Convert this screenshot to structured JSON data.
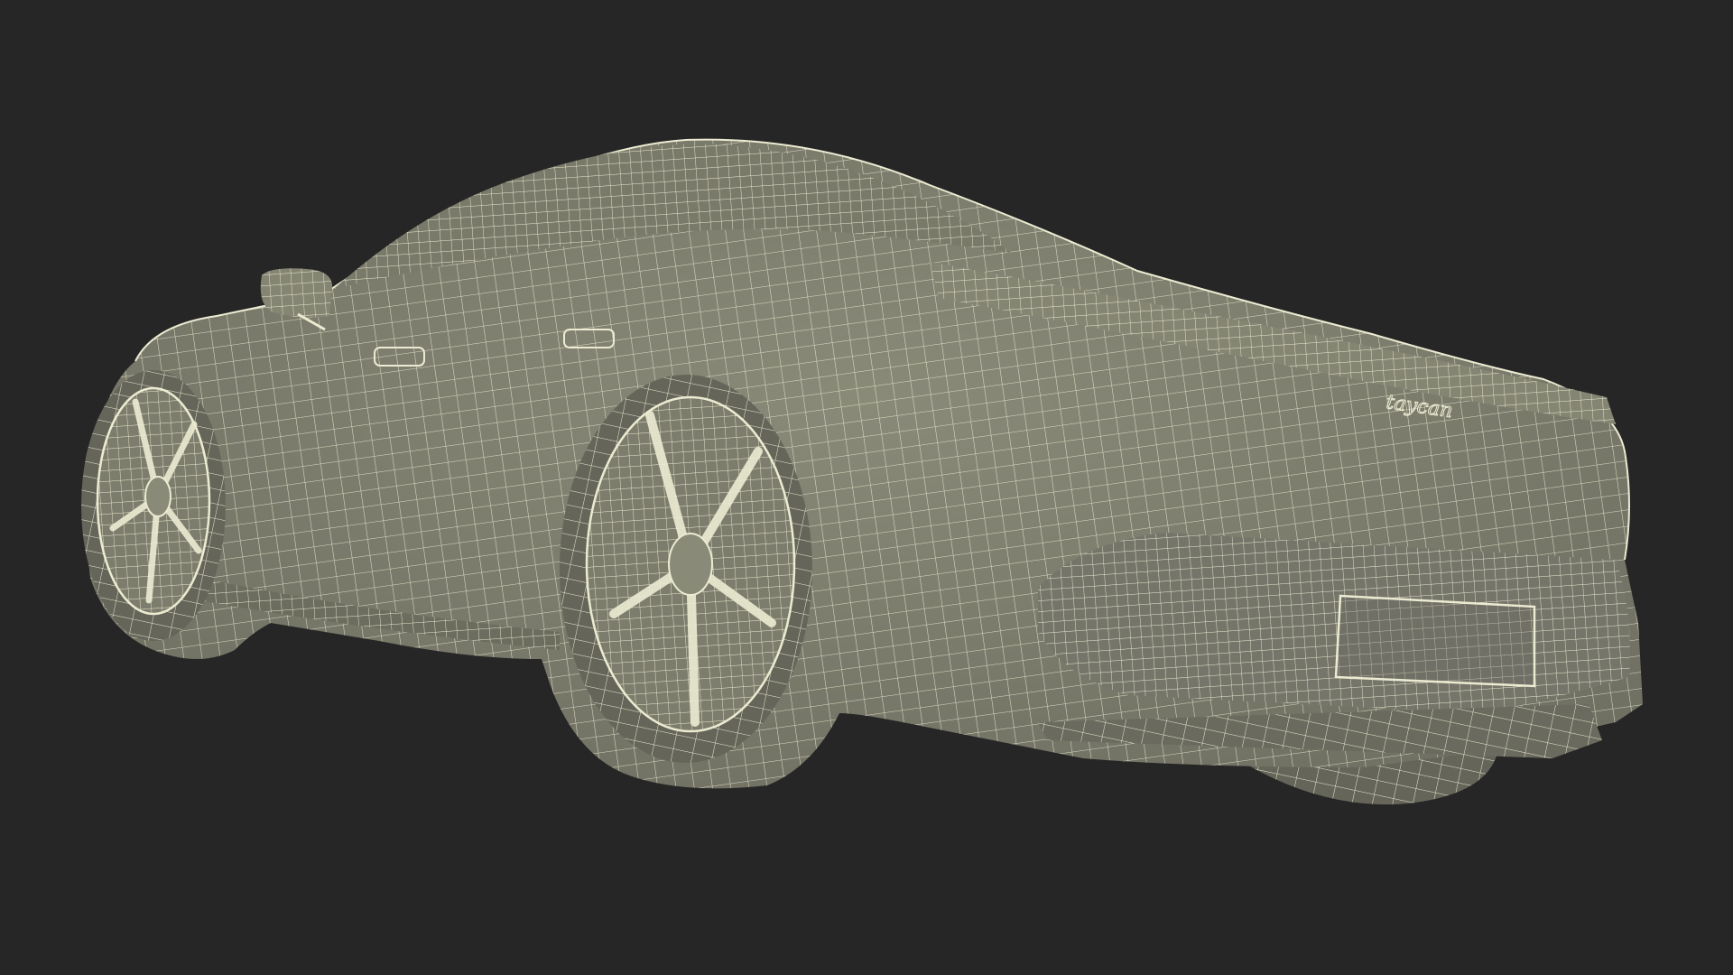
{
  "scene": {
    "background_color": "#262626",
    "body_color": "#7d7d6d",
    "shadow_color": "#65655a",
    "wire_color": "#ecebd2",
    "badge_text": "taycan"
  }
}
